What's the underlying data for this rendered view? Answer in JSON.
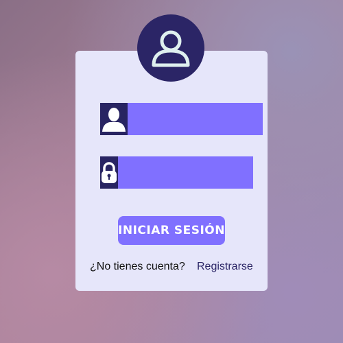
{
  "login": {
    "username": {
      "icon": "user-icon",
      "value": "",
      "placeholder": ""
    },
    "password": {
      "icon": "lock-icon",
      "value": "",
      "placeholder": ""
    },
    "submit_label": "INICIAR SESIÓN",
    "no_account_text": "¿No tienes cuenta?",
    "register_link": "Registrarse",
    "avatar_icon": "user-outline-icon"
  },
  "colors": {
    "accent": "#8070ff",
    "dark": "#282462",
    "card": "#e6e6fa"
  }
}
